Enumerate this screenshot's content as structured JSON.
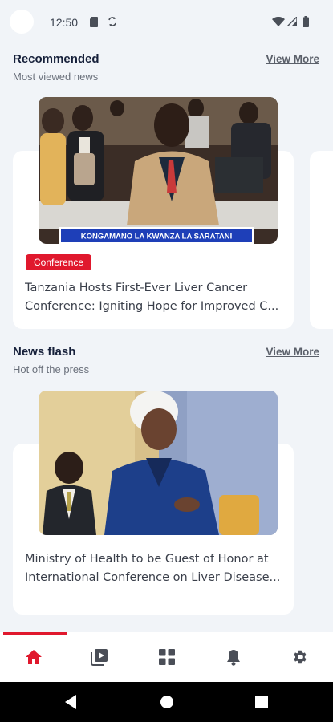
{
  "status_bar": {
    "time": "12:50"
  },
  "recommended": {
    "title": "Recommended",
    "subtitle": "Most viewed news",
    "view_more": "View More",
    "card": {
      "photo_banner": "KONGAMANO LA KWANZA LA SARATANI",
      "tag": "Conference",
      "headline": "Tanzania Hosts First-Ever Liver Cancer Conference: Igniting Hope for Improved C..."
    }
  },
  "news_flash": {
    "title": "News flash",
    "subtitle": "Hot off the press",
    "view_more": "View More",
    "card": {
      "headline": "Ministry of Health to be Guest of Honor at International Conference on Liver Disease..."
    }
  },
  "bottom_nav": {
    "active": "home",
    "items": [
      "home",
      "videos",
      "categories",
      "notifications",
      "settings"
    ],
    "accent_color": "#e0182d",
    "icon_color": "#4a4e57"
  }
}
